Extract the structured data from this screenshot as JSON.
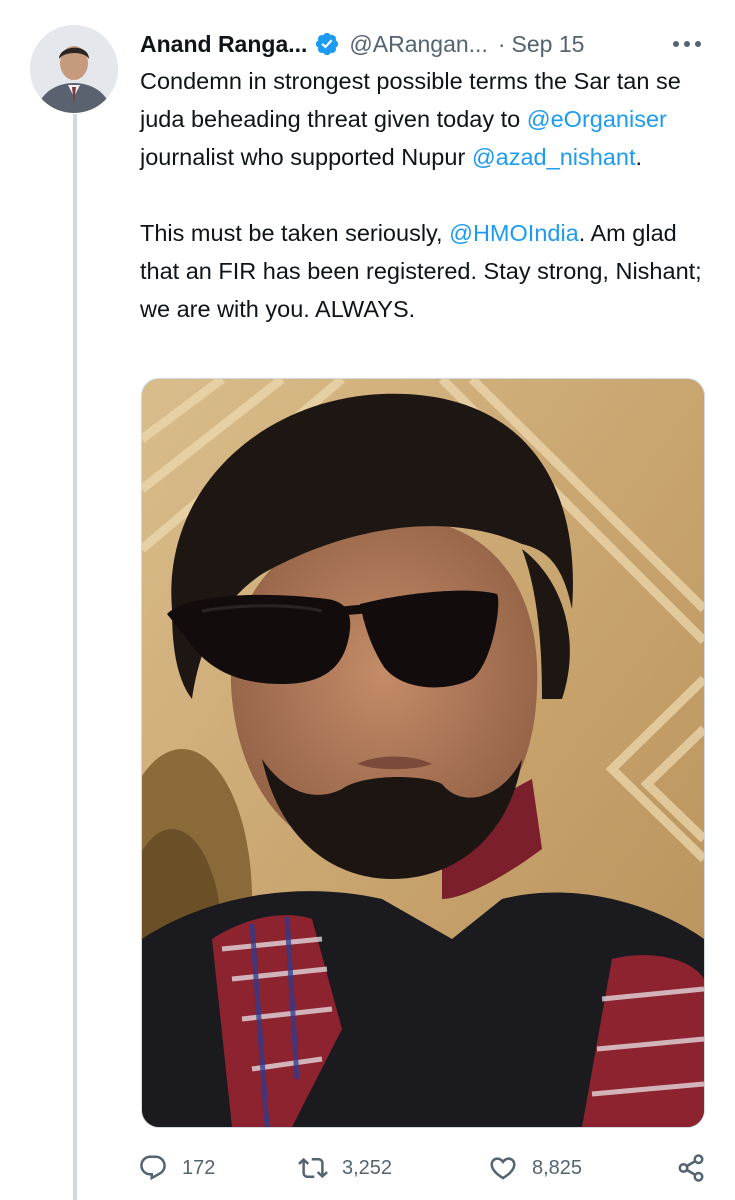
{
  "tweet": {
    "author": {
      "display_name": "Anand Ranga...",
      "handle": "@ARangan...",
      "verified": true,
      "avatar_icon": "profile-avatar"
    },
    "separator": "·",
    "date": "Sep 15",
    "more_icon": "more-horizontal-icon",
    "paragraph1": {
      "t1": "Condemn in strongest possible terms the Sar tan se juda beheading threat given today to ",
      "mention1": "@eOrganiser",
      "t2": " journalist who supported Nupur ",
      "mention2": "@azad_nishant",
      "t3": "."
    },
    "paragraph2": {
      "t1": "This must be taken seriously, ",
      "mention1": "@HMOIndia",
      "t2": ". Am glad that an FIR has been registered. Stay strong, Nishant; we are with you. ALWAYS."
    },
    "media": {
      "type": "photo",
      "subject": "portrait-photo"
    },
    "actions": {
      "replies": "172",
      "retweets": "3,252",
      "likes": "8,825",
      "reply_icon": "reply-icon",
      "retweet_icon": "retweet-icon",
      "like_icon": "heart-icon",
      "share_icon": "share-icon"
    }
  },
  "colors": {
    "accent": "#1d9bf0",
    "text": "#0f1419",
    "secondary": "#536471",
    "thread_line": "#cfd9de"
  }
}
